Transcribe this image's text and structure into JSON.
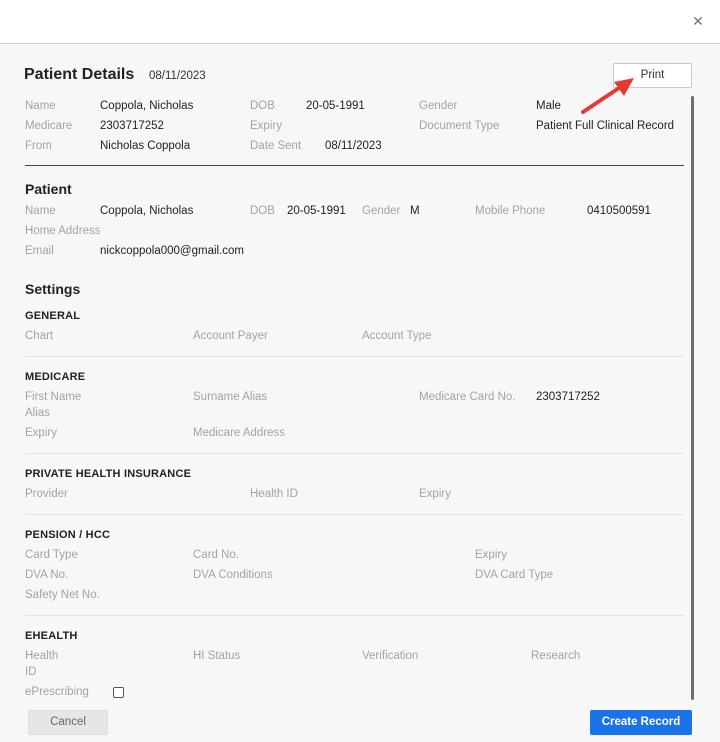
{
  "dialog": {
    "close_icon": "close-icon",
    "close_glyph": "✕"
  },
  "header": {
    "title": "Patient Details",
    "date": "08/11/2023",
    "print_label": "Print"
  },
  "document": {
    "name_label": "Name",
    "name_value": "Coppola, Nicholas",
    "dob_label": "DOB",
    "dob_value": "20-05-1991",
    "gender_label": "Gender",
    "gender_value": "Male",
    "medicare_label": "Medicare",
    "medicare_value": "2303717252",
    "expiry_label": "Expiry",
    "doctype_label": "Document Type",
    "doctype_value": "Patient Full Clinical Record",
    "from_label": "From",
    "from_value": "Nicholas Coppola",
    "datesent_label": "Date Sent",
    "datesent_value": "08/11/2023"
  },
  "patient": {
    "title": "Patient",
    "name_label": "Name",
    "name_value": "Coppola, Nicholas",
    "dob_label": "DOB",
    "dob_value": "20-05-1991",
    "gender_label": "Gender",
    "gender_value": "M",
    "mobile_label": "Mobile Phone",
    "mobile_value": "0410500591",
    "address_label": "Home Address",
    "email_label": "Email",
    "email_value": "nickcoppola000@gmail.com"
  },
  "settings": {
    "title": "Settings",
    "general": {
      "title": "GENERAL",
      "chart_label": "Chart",
      "payer_label": "Account Payer",
      "type_label": "Account Type"
    },
    "medicare": {
      "title": "MEDICARE",
      "firstname_label_1": "First Name",
      "firstname_label_2": "Alias",
      "surname_label": "Surname Alias",
      "cardno_label": "Medicare Card No.",
      "cardno_value": "2303717252",
      "expiry_label": "Expiry",
      "address_label": "Medicare Address"
    },
    "phi": {
      "title": "PRIVATE HEALTH INSURANCE",
      "provider_label": "Provider",
      "healthid_label": "Health ID",
      "expiry_label": "Expiry"
    },
    "pension": {
      "title": "PENSION / HCC",
      "cardtype_label": "Card Type",
      "cardno_label": "Card No.",
      "expiry_label": "Expiry",
      "dvano_label": "DVA No.",
      "dvacond_label": "DVA Conditions",
      "dvacardtype_label": "DVA Card Type",
      "safetynet_label": "Safety Net No."
    },
    "ehealth": {
      "title": "EHEALTH",
      "healthid_label_1": "Health",
      "healthid_label_2": "ID",
      "histatus_label": "HI Status",
      "verification_label": "Verification",
      "research_label": "Research",
      "eprescribing_label": "ePrescribing",
      "eprescribing_checked": false
    }
  },
  "footer": {
    "cancel_label": "Cancel",
    "create_label": "Create Record"
  },
  "colors": {
    "accent": "#1a73e8",
    "annotation_arrow": "#e53935"
  }
}
